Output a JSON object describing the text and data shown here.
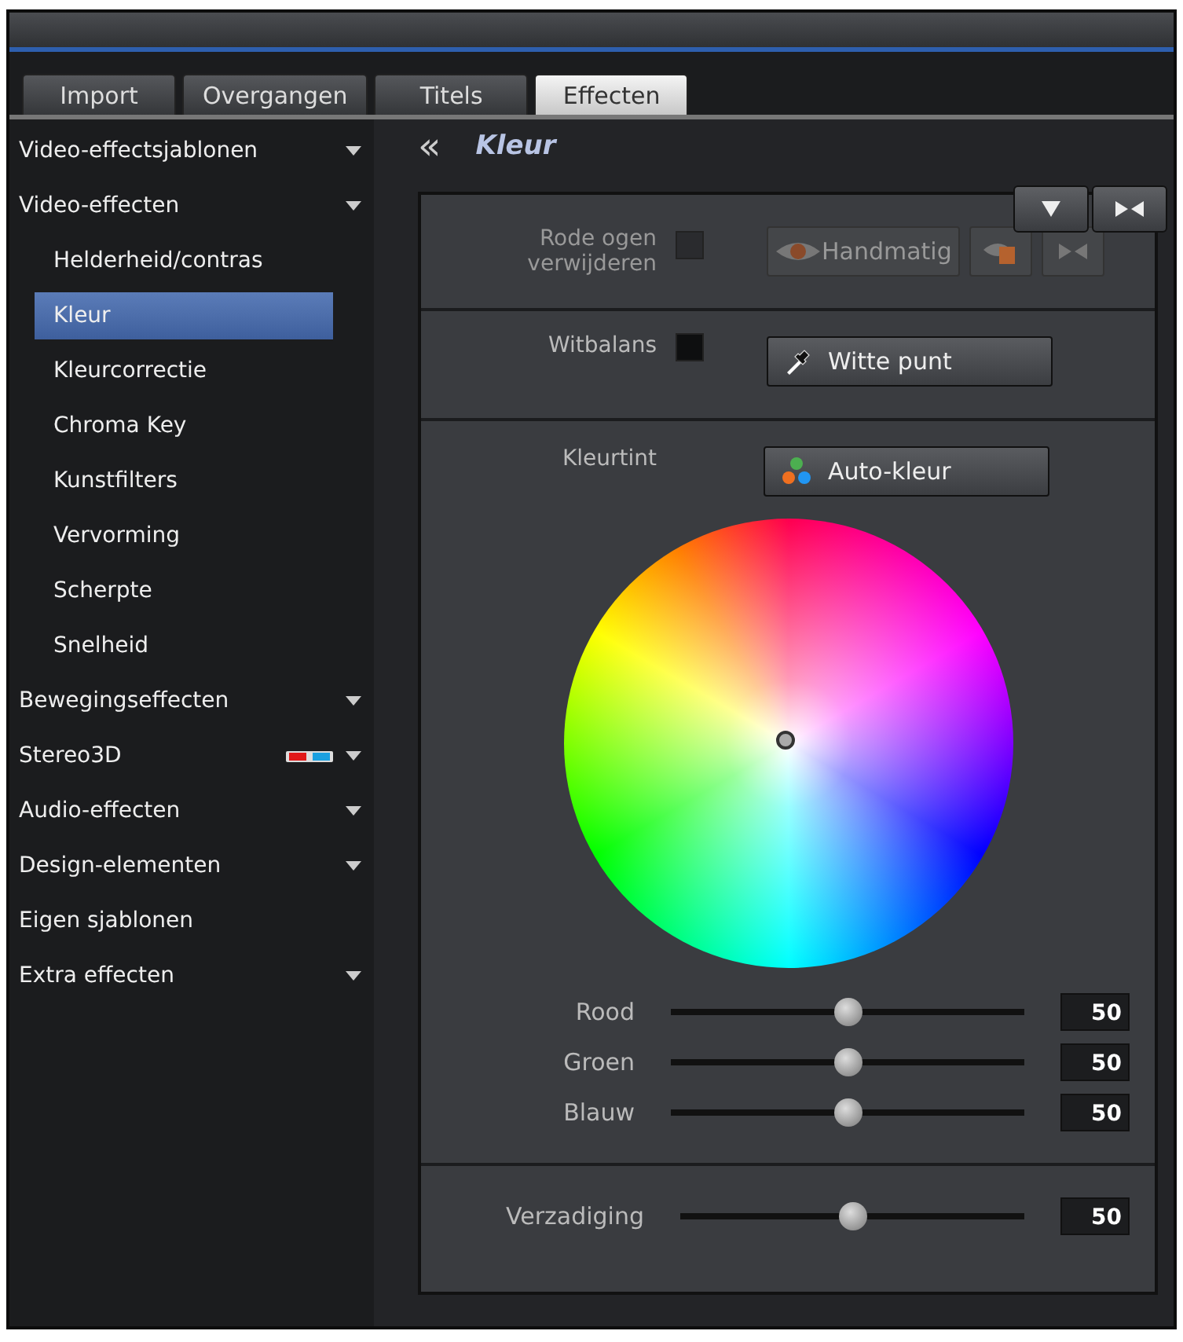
{
  "tabs": [
    {
      "label": "Import",
      "selected": false
    },
    {
      "label": "Overgangen",
      "selected": false
    },
    {
      "label": "Titels",
      "selected": false
    },
    {
      "label": "Effecten",
      "selected": true
    }
  ],
  "sidebar": {
    "items": [
      {
        "label": "Video-effectsjablonen",
        "expandable": true,
        "selected": false
      },
      {
        "label": "Video-effecten",
        "expandable": true,
        "selected": false,
        "children": [
          {
            "label": "Helderheid/contras",
            "selected": false
          },
          {
            "label": "Kleur",
            "selected": true
          },
          {
            "label": "Kleurcorrectie",
            "selected": false
          },
          {
            "label": "Chroma Key",
            "selected": false
          },
          {
            "label": "Kunstfilters",
            "selected": false
          },
          {
            "label": "Vervorming",
            "selected": false
          },
          {
            "label": "Scherpte",
            "selected": false
          },
          {
            "label": "Snelheid",
            "selected": false
          }
        ]
      },
      {
        "label": "Bewegingseffecten",
        "expandable": true,
        "selected": false
      },
      {
        "label": "Stereo3D",
        "expandable": true,
        "selected": false,
        "glasses": true
      },
      {
        "label": "Audio-effecten",
        "expandable": true,
        "selected": false
      },
      {
        "label": "Design-elementen",
        "expandable": true,
        "selected": false
      },
      {
        "label": "Eigen sjablonen",
        "expandable": false,
        "selected": false
      },
      {
        "label": "Extra effecten",
        "expandable": true,
        "selected": false
      }
    ]
  },
  "panel": {
    "back": "«",
    "title": "Kleur",
    "red_eye": {
      "label": "Rode ogen verwijderen",
      "checked": false,
      "disabled": true,
      "button": "Handmatig"
    },
    "white_balance": {
      "label": "Witbalans",
      "checked": false,
      "button": "Witte punt"
    },
    "tint": {
      "label": "Kleurtint",
      "button": "Auto-kleur"
    },
    "sliders": [
      {
        "label": "Rood",
        "level": 0.5,
        "value": "50"
      },
      {
        "label": "Groen",
        "level": 0.5,
        "value": "50"
      },
      {
        "label": "Blauw",
        "level": 0.5,
        "value": "50"
      }
    ],
    "saturation": {
      "label": "Verzadiging",
      "level": 0.5,
      "value": "50"
    }
  }
}
